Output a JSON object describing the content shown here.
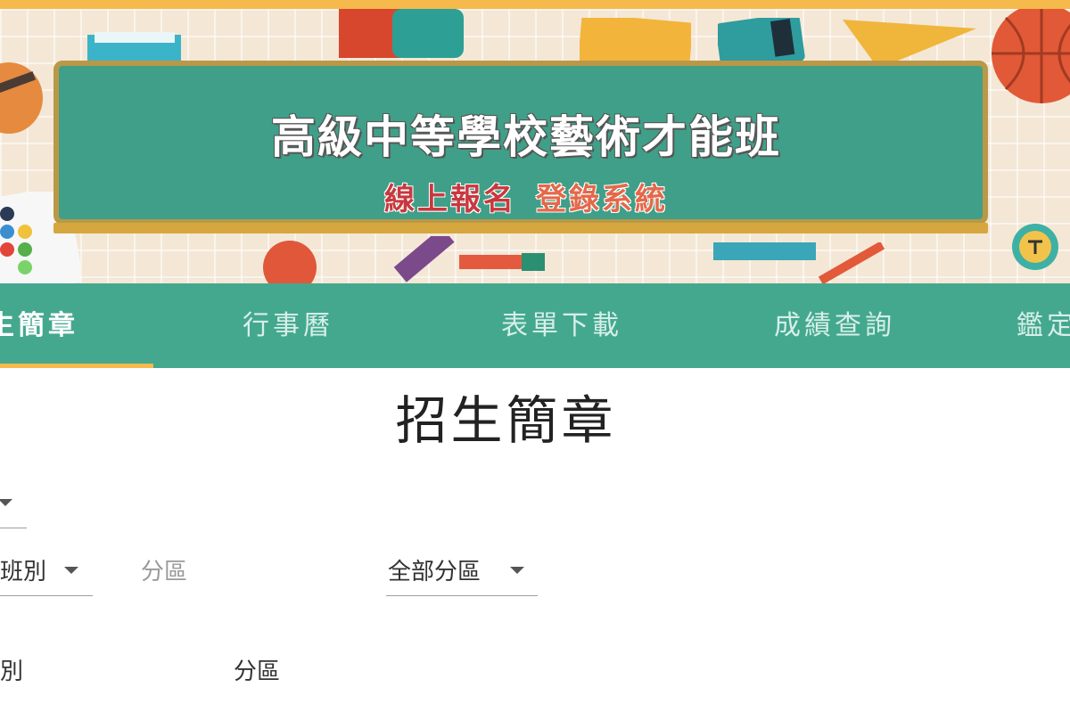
{
  "banner": {
    "title": "高級中等學校藝術才能班",
    "subtitle_part1": "線上報名",
    "subtitle_part2": "登錄系統"
  },
  "nav": {
    "items": [
      {
        "label": "生簡章",
        "active": true
      },
      {
        "label": "行事曆"
      },
      {
        "label": "表單下載"
      },
      {
        "label": "成績查詢"
      },
      {
        "label": "鑑定"
      }
    ]
  },
  "main": {
    "title": "招生簡章",
    "filters": {
      "class_select_value": "班別",
      "region_label": "分區",
      "region_select_value": "全部分區"
    },
    "table_headers": [
      "別",
      "分區"
    ]
  },
  "colors": {
    "accent": "#f6b94b",
    "nav_bg": "#44a88f",
    "board": "#3f9f88"
  }
}
